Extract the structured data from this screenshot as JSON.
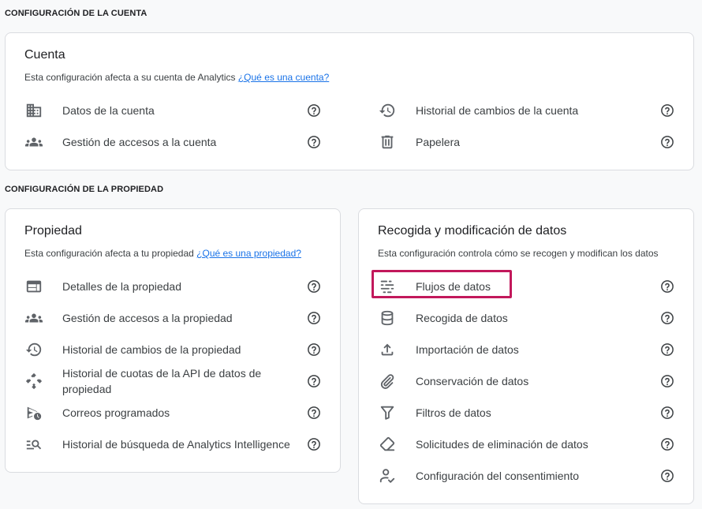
{
  "sections": {
    "account_title": "CONFIGURACIÓN DE LA CUENTA",
    "property_title": "CONFIGURACIÓN DE LA PROPIEDAD"
  },
  "account_card": {
    "title": "Cuenta",
    "description": "Esta configuración afecta a su cuenta de Analytics",
    "link": "¿Qué es una cuenta?",
    "items": [
      {
        "label": "Datos de la cuenta",
        "icon": "building-icon"
      },
      {
        "label": "Gestión de accesos a la cuenta",
        "icon": "group-icon"
      },
      {
        "label": "Historial de cambios de la cuenta",
        "icon": "history-icon"
      },
      {
        "label": "Papelera",
        "icon": "trash-icon"
      }
    ]
  },
  "property_card": {
    "title": "Propiedad",
    "description": "Esta configuración afecta a tu propiedad",
    "link": "¿Qué es una propiedad?",
    "items": [
      {
        "label": "Detalles de la propiedad",
        "icon": "web-window-icon"
      },
      {
        "label": "Gestión de accesos a la propiedad",
        "icon": "group-icon"
      },
      {
        "label": "Historial de cambios de la propiedad",
        "icon": "history-icon"
      },
      {
        "label": "Historial de cuotas de la API de datos de propiedad",
        "icon": "api-icon"
      },
      {
        "label": "Correos programados",
        "icon": "scheduled-send-icon"
      },
      {
        "label": "Historial de búsqueda de Analytics Intelligence",
        "icon": "manage-search-icon"
      }
    ]
  },
  "data_card": {
    "title": "Recogida y modificación de datos",
    "description": "Esta configuración controla cómo se recogen y modifican los datos",
    "items": [
      {
        "label": "Flujos de datos",
        "icon": "data-streams-icon",
        "highlighted": true
      },
      {
        "label": "Recogida de datos",
        "icon": "database-icon"
      },
      {
        "label": "Importación de datos",
        "icon": "upload-icon"
      },
      {
        "label": "Conservación de datos",
        "icon": "attach-icon"
      },
      {
        "label": "Filtros de datos",
        "icon": "filter-icon"
      },
      {
        "label": "Solicitudes de eliminación de datos",
        "icon": "eraser-icon"
      },
      {
        "label": "Configuración del consentimiento",
        "icon": "consent-icon"
      }
    ]
  },
  "colors": {
    "highlight": "#c2185b",
    "link": "#1a73e8",
    "icon": "#5f6368"
  }
}
